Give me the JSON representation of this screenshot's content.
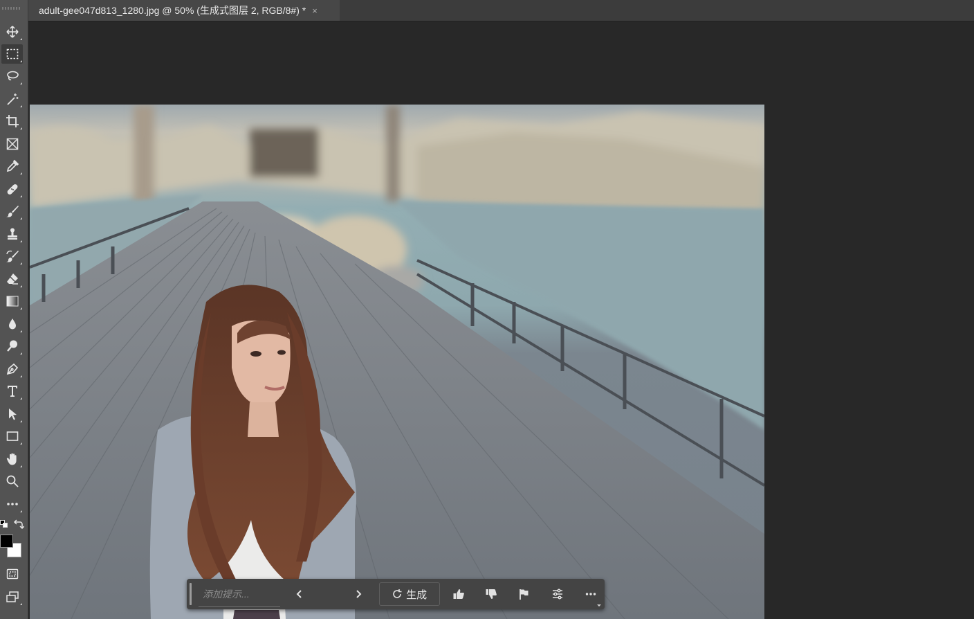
{
  "document_tab": {
    "title": "adult-gee047d813_1280.jpg @ 50% (生成式图层 2, RGB/8#) *",
    "close_glyph": "×"
  },
  "toolbar": {
    "tools": [
      {
        "name": "move-tool",
        "icon": "move-icon"
      },
      {
        "name": "rectangular-marquee-tool",
        "icon": "marquee-icon",
        "selected": true
      },
      {
        "name": "lasso-tool",
        "icon": "lasso-icon"
      },
      {
        "name": "magic-wand-tool",
        "icon": "magic-wand-icon"
      },
      {
        "name": "crop-tool",
        "icon": "crop-icon"
      },
      {
        "name": "frame-tool",
        "icon": "frame-icon"
      },
      {
        "name": "eyedropper-tool",
        "icon": "eyedropper-icon"
      },
      {
        "name": "healing-brush-tool",
        "icon": "bandage-icon"
      },
      {
        "name": "brush-tool",
        "icon": "brush-icon"
      },
      {
        "name": "clone-stamp-tool",
        "icon": "stamp-icon"
      },
      {
        "name": "history-brush-tool",
        "icon": "history-brush-icon"
      },
      {
        "name": "eraser-tool",
        "icon": "eraser-icon"
      },
      {
        "name": "gradient-tool",
        "icon": "gradient-icon"
      },
      {
        "name": "blur-tool",
        "icon": "drop-icon"
      },
      {
        "name": "dodge-tool",
        "icon": "dodge-icon"
      },
      {
        "name": "pen-tool",
        "icon": "pen-icon"
      },
      {
        "name": "type-tool",
        "icon": "type-icon"
      },
      {
        "name": "path-selection-tool",
        "icon": "arrow-icon"
      },
      {
        "name": "rectangle-tool",
        "icon": "rectangle-icon"
      },
      {
        "name": "hand-tool",
        "icon": "hand-icon"
      },
      {
        "name": "zoom-tool",
        "icon": "zoom-icon"
      },
      {
        "name": "more-tools",
        "icon": "more-icon"
      }
    ],
    "foreground_color": "#000000",
    "background_color": "#ffffff"
  },
  "taskbar": {
    "prompt_placeholder": "添加提示...",
    "generate_label": "生成"
  },
  "colors": {
    "app_bg": "#282828",
    "toolbar_bg": "#535353",
    "tab_active_bg": "#474747",
    "taskbar_bg": "#444444"
  }
}
